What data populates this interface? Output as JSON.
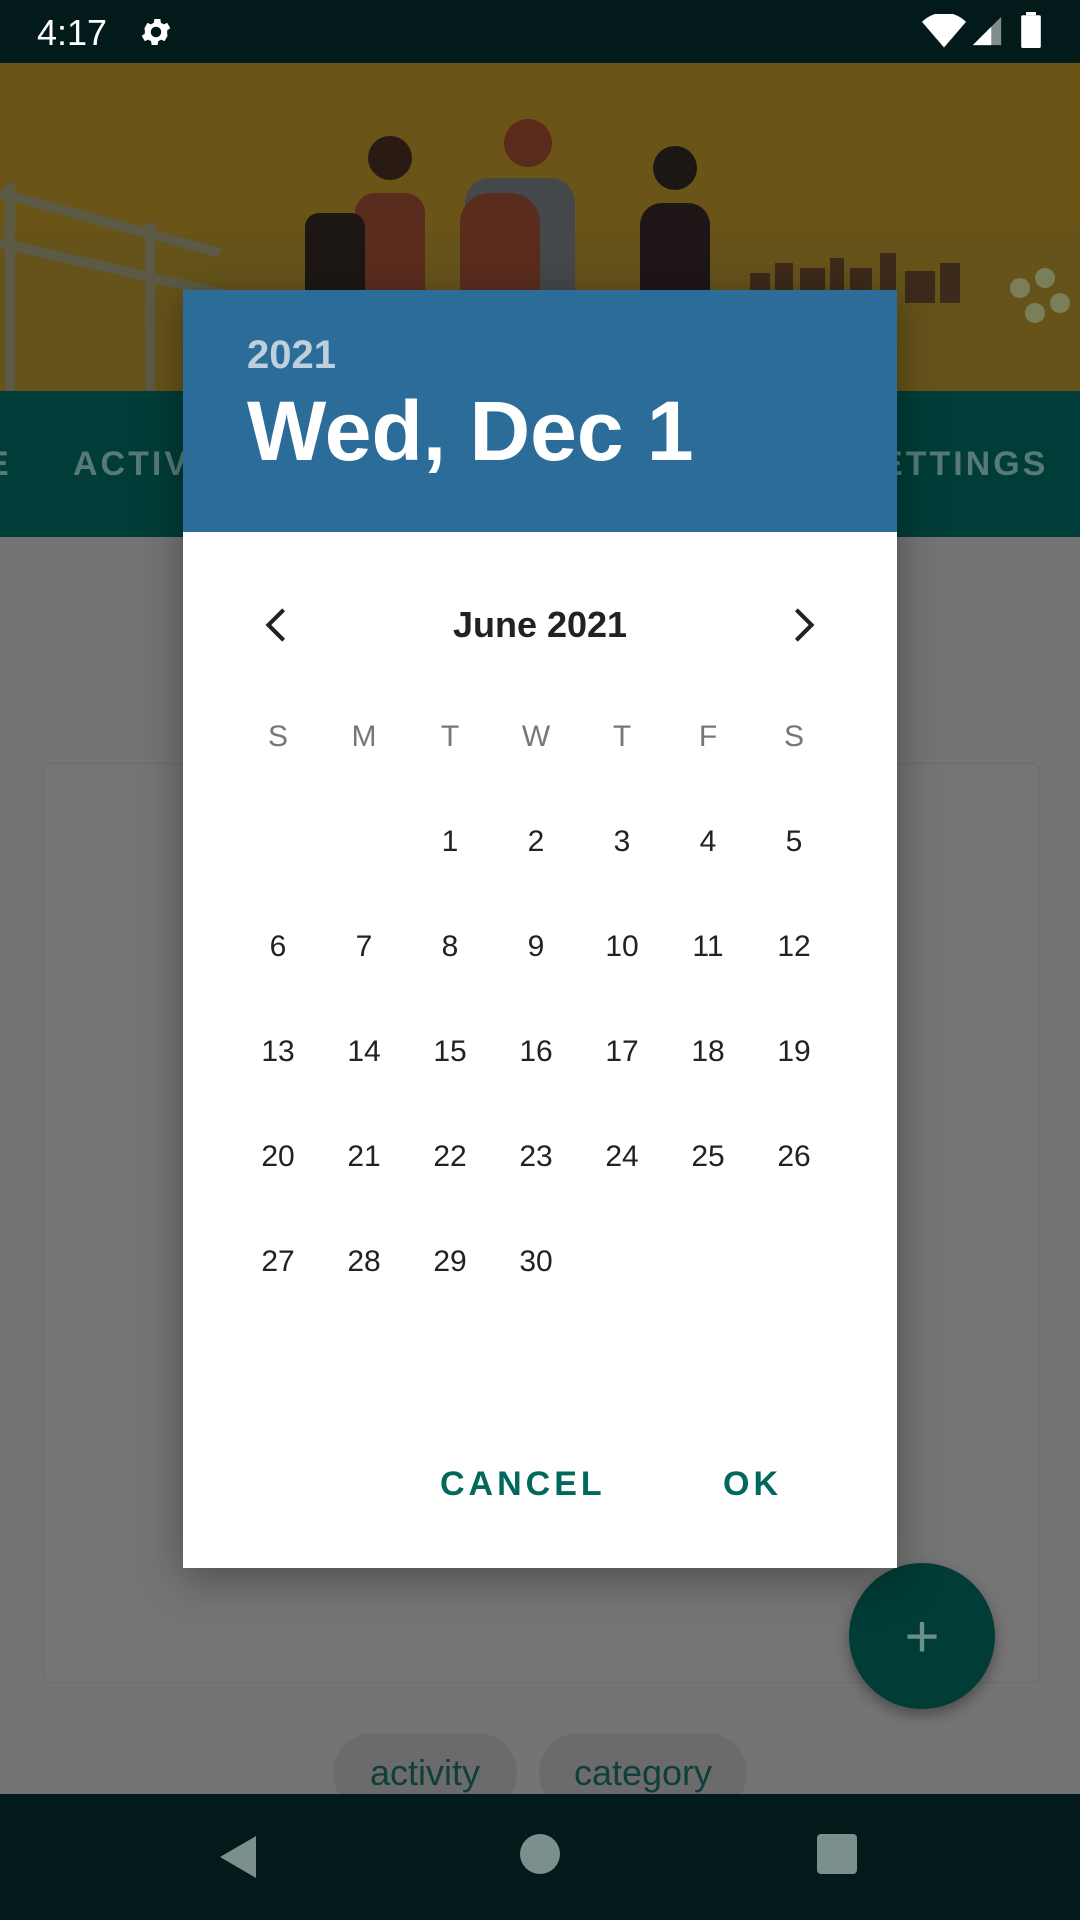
{
  "status_bar": {
    "time": "4:17"
  },
  "tabs": {
    "left_partial": "E",
    "activity": "ACTIV",
    "settings": "ETTINGS"
  },
  "chips": {
    "activity": "activity",
    "category": "category"
  },
  "fab": {
    "symbol": "+"
  },
  "dialog": {
    "year": "2021",
    "selected_date": "Wed, Dec 1",
    "month_title": "June 2021",
    "weekdays": [
      "S",
      "M",
      "T",
      "W",
      "T",
      "F",
      "S"
    ],
    "days": [
      "1",
      "2",
      "3",
      "4",
      "5",
      "6",
      "7",
      "8",
      "9",
      "10",
      "11",
      "12",
      "13",
      "14",
      "15",
      "16",
      "17",
      "18",
      "19",
      "20",
      "21",
      "22",
      "23",
      "24",
      "25",
      "26",
      "27",
      "28",
      "29",
      "30"
    ],
    "cancel_label": "CANCEL",
    "ok_label": "OK"
  },
  "colors": {
    "header_blue": "#2b6c98",
    "accent": "#00695c",
    "tab_bar": "#003d38"
  }
}
